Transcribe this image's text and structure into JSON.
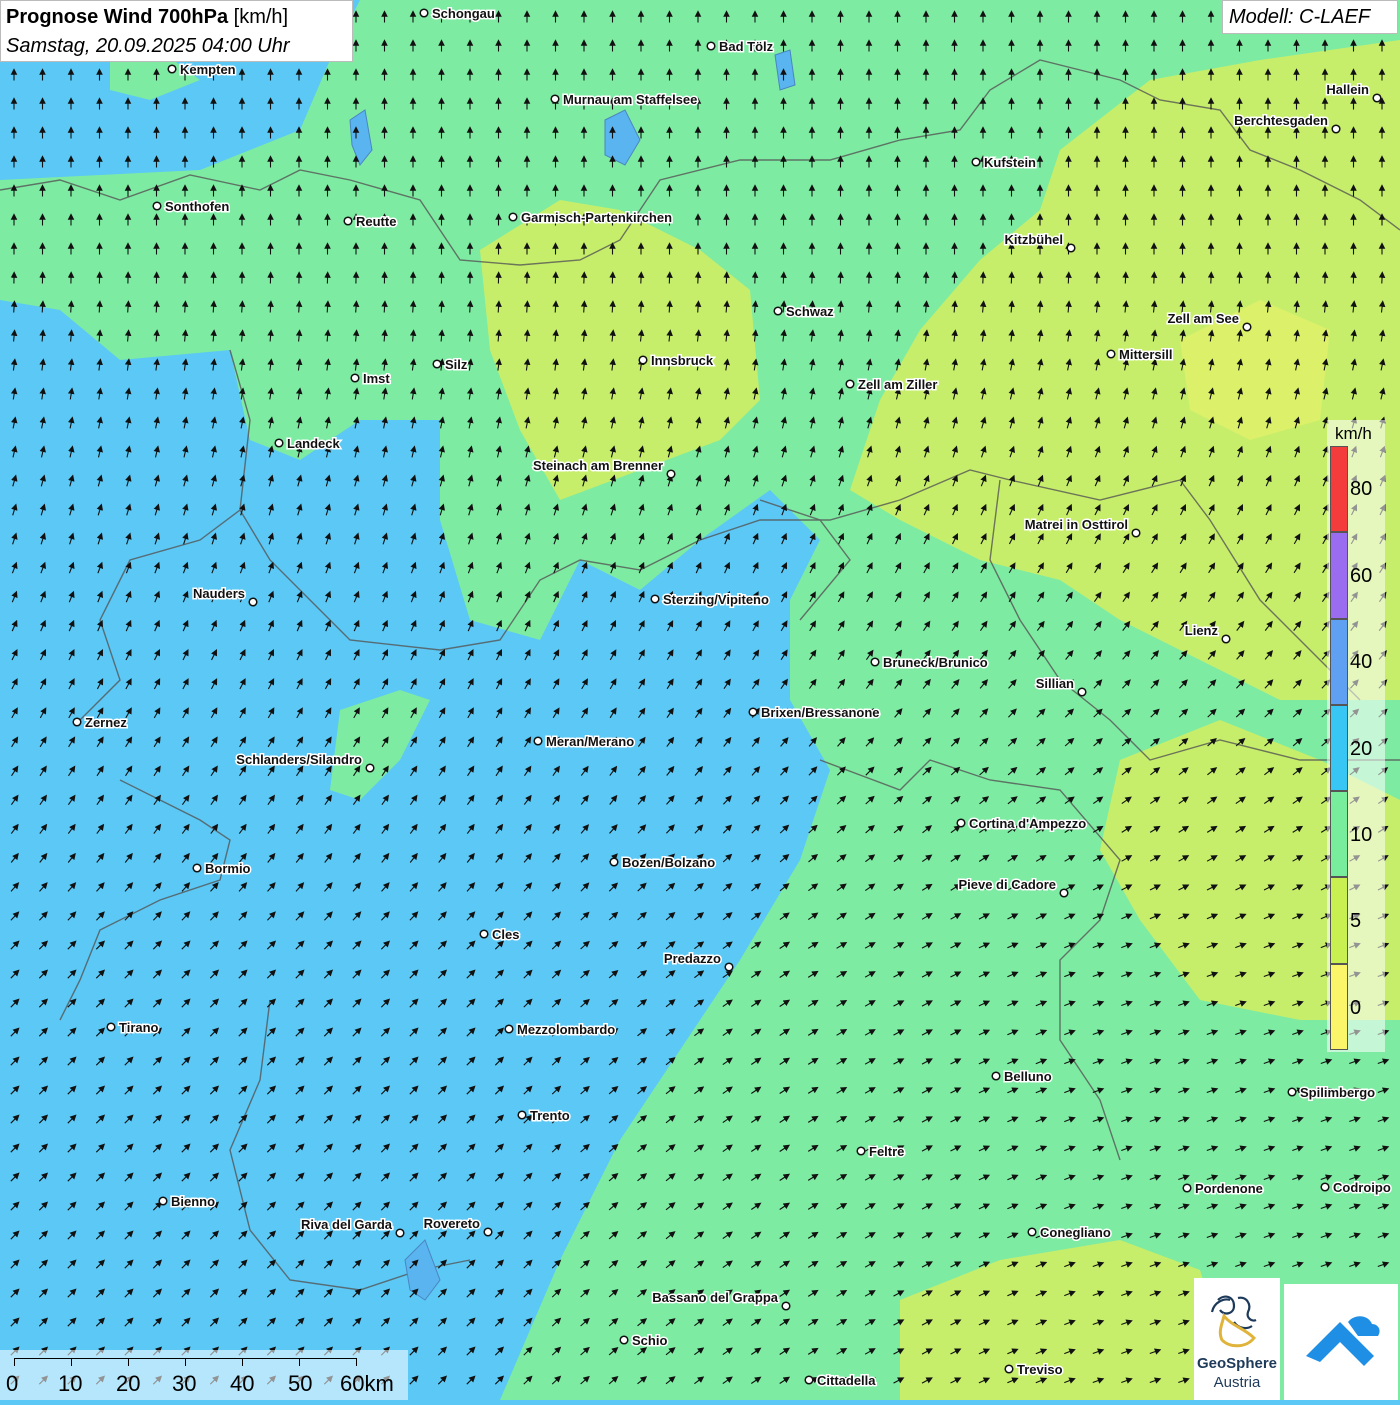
{
  "title": {
    "main": "Prognose Wind 700hPa",
    "unit": "[km/h]",
    "datetime": "Samstag, 20.09.2025 04:00 Uhr"
  },
  "model": "Modell: C-LAEF",
  "legend": {
    "unit": "km/h",
    "labels": [
      "80",
      "60",
      "40",
      "20",
      "10",
      "5",
      "0"
    ],
    "colors": [
      "#f53c3c",
      "#9a6cf0",
      "#5fa0f2",
      "#38c6f4",
      "#78ee9c",
      "#c8f050",
      "#fbf56a"
    ]
  },
  "scalebar": {
    "labels": [
      "0",
      "10",
      "20",
      "30",
      "40",
      "50",
      "60km"
    ]
  },
  "cities": [
    {
      "name": "Schongau"
    },
    {
      "name": "Bad Tölz"
    },
    {
      "name": "Kempten"
    },
    {
      "name": "Murnau am Staffelsee"
    },
    {
      "name": "Hallein"
    },
    {
      "name": "Berchtesgaden"
    },
    {
      "name": "Kufstein"
    },
    {
      "name": "Sonthofen"
    },
    {
      "name": "Reutte"
    },
    {
      "name": "Garmisch-Partenkirchen"
    },
    {
      "name": "Kitzbühel"
    },
    {
      "name": "Schwaz"
    },
    {
      "name": "Zell am See"
    },
    {
      "name": "Mittersill"
    },
    {
      "name": "Innsbruck"
    },
    {
      "name": "Imst"
    },
    {
      "name": "Silz"
    },
    {
      "name": "Zell am Ziller"
    },
    {
      "name": "Landeck"
    },
    {
      "name": "Steinach am Brenner"
    },
    {
      "name": "Matrei in Osttirol"
    },
    {
      "name": "Nauders"
    },
    {
      "name": "Sterzing/Vipiteno"
    },
    {
      "name": "Lienz"
    },
    {
      "name": "Bruneck/Brunico"
    },
    {
      "name": "Sillian"
    },
    {
      "name": "Brixen/Bressanone"
    },
    {
      "name": "Zernez"
    },
    {
      "name": "Meran/Merano"
    },
    {
      "name": "Schlanders/Silandro"
    },
    {
      "name": "Cortina d'Ampezzo"
    },
    {
      "name": "Bozen/Bolzano"
    },
    {
      "name": "Bormio"
    },
    {
      "name": "Pieve di Cadore"
    },
    {
      "name": "Cles"
    },
    {
      "name": "Predazzo"
    },
    {
      "name": "Tirano"
    },
    {
      "name": "Mezzolombardo"
    },
    {
      "name": "Belluno"
    },
    {
      "name": "Spilimbergo"
    },
    {
      "name": "Trento"
    },
    {
      "name": "Feltre"
    },
    {
      "name": "Pordenone"
    },
    {
      "name": "Codroipo"
    },
    {
      "name": "Bienno"
    },
    {
      "name": "Riva del Garda"
    },
    {
      "name": "Rovereto"
    },
    {
      "name": "Conegliano"
    },
    {
      "name": "Bassano del Grappa"
    },
    {
      "name": "Schio"
    },
    {
      "name": "Treviso"
    },
    {
      "name": "Cittadella"
    }
  ],
  "logos": {
    "geosphere_line1": "GeoSphere",
    "geosphere_line2": "Austria"
  }
}
